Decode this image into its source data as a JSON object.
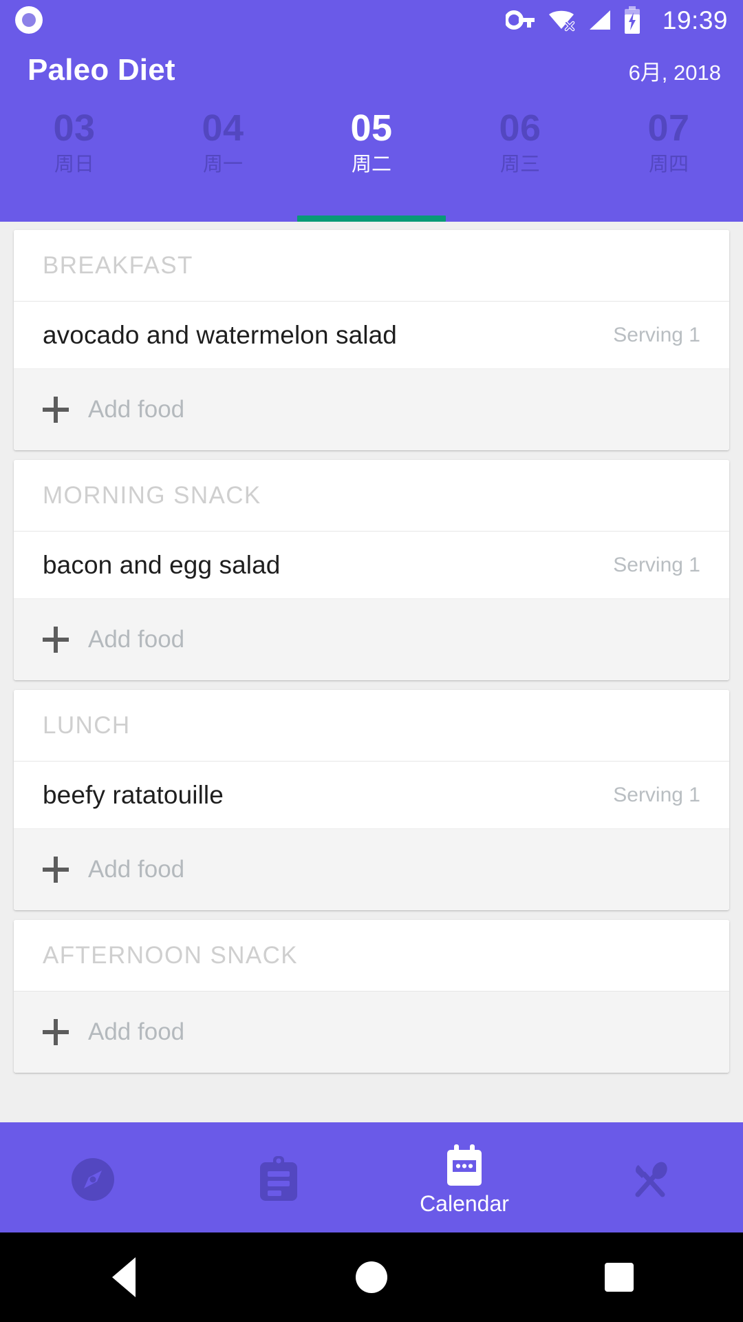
{
  "status_bar": {
    "icons": [
      "record-dot-icon",
      "vpn-key-icon",
      "wifi-off-icon",
      "signal-cellular-icon",
      "battery-charging-icon"
    ],
    "time": "19:39"
  },
  "app_bar": {
    "title": "Paleo Diet",
    "date": "6月, 2018"
  },
  "day_tabs": {
    "days": [
      {
        "number": "03",
        "weekday": "周日",
        "active": false
      },
      {
        "number": "04",
        "weekday": "周一",
        "active": false
      },
      {
        "number": "05",
        "weekday": "周二",
        "active": true
      },
      {
        "number": "06",
        "weekday": "周三",
        "active": false
      },
      {
        "number": "07",
        "weekday": "周四",
        "active": false
      }
    ],
    "indicator_color": "#089A77"
  },
  "meals": [
    {
      "title": "BREAKFAST",
      "foods": [
        {
          "name": "avocado and watermelon salad",
          "serving": "Serving 1"
        }
      ],
      "add_label": "Add food"
    },
    {
      "title": "MORNING SNACK",
      "foods": [
        {
          "name": "bacon and egg salad",
          "serving": "Serving 1"
        }
      ],
      "add_label": "Add food"
    },
    {
      "title": "LUNCH",
      "foods": [
        {
          "name": "beefy ratatouille",
          "serving": "Serving 1"
        }
      ],
      "add_label": "Add food"
    },
    {
      "title": "AFTERNOON SNACK",
      "foods": [],
      "add_label": "Add food"
    }
  ],
  "bottom_nav": {
    "items": [
      {
        "icon": "explore-compass-icon",
        "label": "",
        "active": false
      },
      {
        "icon": "clipboard-assignment-icon",
        "label": "",
        "active": false
      },
      {
        "icon": "calendar-icon",
        "label": "Calendar",
        "active": true
      },
      {
        "icon": "restaurant-icon",
        "label": "",
        "active": false
      }
    ]
  },
  "android_nav": {
    "back": "back-button",
    "home": "home-button",
    "recents": "recents-button"
  },
  "colors": {
    "primary": "#6A5AE8",
    "accent": "#089A77",
    "inactive_tab": "#5347C0",
    "page_bg": "#EFEFEF",
    "card_bg": "#FFFFFF",
    "add_food_bg": "#F4F4F4"
  }
}
